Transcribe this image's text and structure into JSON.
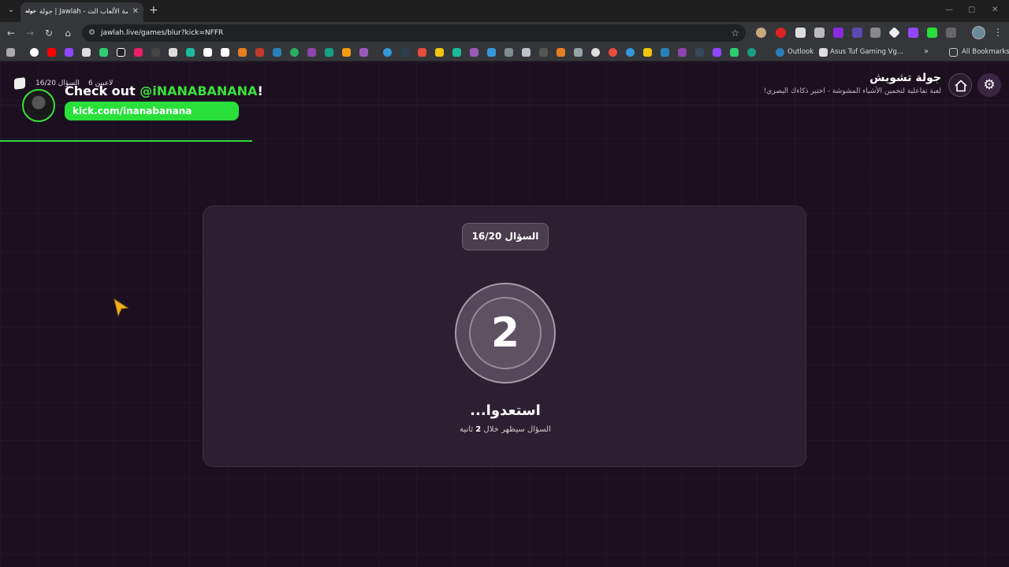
{
  "browser": {
    "tab_title": "جولة | Jawlah - منصة الألعاب الت...",
    "tab_favicon_text": "جولة",
    "url": "jawlah.live/games/blur?kick=NFFR",
    "bookmarks": {
      "outlook": "Outlook",
      "asus": "Asus Tuf Gaming Vg...",
      "all": "All Bookmarks"
    }
  },
  "header": {
    "title": "جولة تشويش",
    "subtitle": "لعبة تفاعلية لتخمين الأشياء المشوشة - اختبر ذكاءك البصري!",
    "status_players": "6 لاعبين",
    "status_question": "السؤال 16/20"
  },
  "promo": {
    "prefix": "Check out ",
    "handle": "@iNANABANANA",
    "suffix": "!",
    "link": "kick.com/inanabanana"
  },
  "card": {
    "question_badge": "السؤال 16/20",
    "countdown": "2",
    "ready": "استعدوا...",
    "sub_before": "السؤال سيظهر خلال ",
    "sub_num": "2",
    "sub_after": " ثانية"
  },
  "colors": {
    "page_bg": "#1c1020",
    "card_bg": "#2c1f31",
    "kick_green": "#29e03a",
    "cursor": "#f0b020"
  }
}
